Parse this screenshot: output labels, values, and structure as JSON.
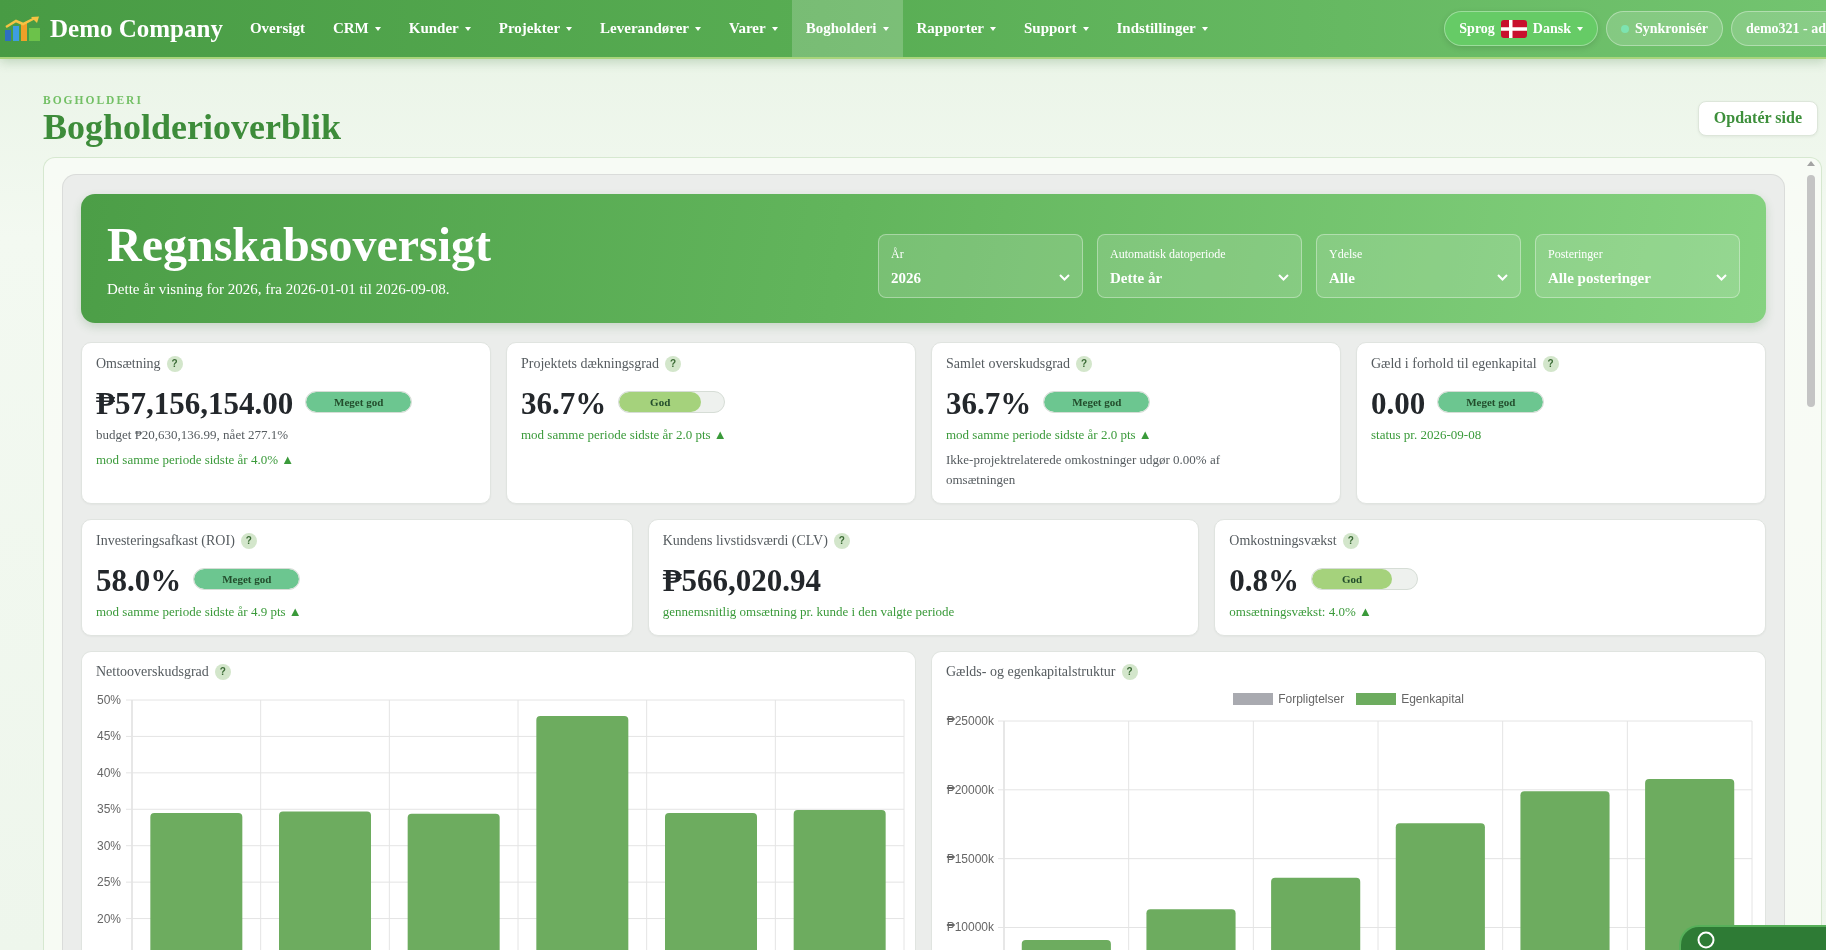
{
  "nav": {
    "brand": "Demo Company",
    "items": [
      {
        "label": "Oversigt",
        "has_menu": false,
        "selected": false
      },
      {
        "label": "CRM",
        "has_menu": true,
        "selected": false
      },
      {
        "label": "Kunder",
        "has_menu": true,
        "selected": false
      },
      {
        "label": "Projekter",
        "has_menu": true,
        "selected": false
      },
      {
        "label": "Leverandører",
        "has_menu": true,
        "selected": false
      },
      {
        "label": "Varer",
        "has_menu": true,
        "selected": false
      },
      {
        "label": "Bogholderi",
        "has_menu": true,
        "selected": true
      },
      {
        "label": "Rapporter",
        "has_menu": true,
        "selected": false
      },
      {
        "label": "Support",
        "has_menu": true,
        "selected": false
      },
      {
        "label": "Indstillinger",
        "has_menu": true,
        "selected": false
      }
    ],
    "language": {
      "label": "Sprog",
      "value": "Dansk"
    },
    "sync": {
      "label": "Synkronisér",
      "online": true
    },
    "user": {
      "label": "demo321 - ad"
    }
  },
  "header": {
    "eyebrow": "BOGHOLDERI",
    "title": "Bogholderioverblik",
    "refresh_button": "Opdatér side"
  },
  "banner": {
    "title": "Regnskabsoversigt",
    "subtitle": "Dette år visning for 2026, fra 2026-01-01 til 2026-09-08.",
    "filters": [
      {
        "label": "År",
        "value": "2026"
      },
      {
        "label": "Automatisk datoperiode",
        "value": "Dette år"
      },
      {
        "label": "Ydelse",
        "value": "Alle"
      },
      {
        "label": "Posteringer",
        "value": "Alle posteringer"
      }
    ]
  },
  "kpi_rows": [
    {
      "cards": [
        {
          "title": "Omsætning",
          "help": "?",
          "value": "₱57,156,154.00",
          "rating": {
            "label": "Meget god",
            "level": 1,
            "color": "#6cc690"
          },
          "notes": [
            {
              "text": "budget ₱20,630,136.99, nået 277.1%",
              "kind": "muted"
            },
            {
              "text": "mod samme periode sidste år 4.0% ▲",
              "kind": "accent"
            }
          ]
        },
        {
          "title": "Projektets dækningsgrad",
          "help": "?",
          "value": "36.7%",
          "rating": {
            "label": "God",
            "level": 0.78,
            "color": "#a5d27c"
          },
          "notes": [
            {
              "text": "mod samme periode sidste år 2.0 pts ▲",
              "kind": "accent"
            }
          ]
        },
        {
          "title": "Samlet overskudsgrad",
          "help": "?",
          "value": "36.7%",
          "rating": {
            "label": "Meget god",
            "level": 1,
            "color": "#6cc690"
          },
          "notes": [
            {
              "text": "mod samme periode sidste år 2.0 pts ▲",
              "kind": "accent"
            },
            {
              "text": "Ikke-projektrelaterede omkostninger udgør 0.00% af omsætningen",
              "kind": "muted"
            }
          ]
        },
        {
          "title": "Gæld i forhold til egenkapital",
          "help": "?",
          "value": "0.00",
          "rating": {
            "label": "Meget god",
            "level": 1,
            "color": "#6cc690"
          },
          "notes": [
            {
              "text": "status pr. 2026-09-08",
              "kind": "accent"
            }
          ]
        }
      ]
    },
    {
      "cards": [
        {
          "title": "Investeringsafkast (ROI)",
          "help": "?",
          "value": "58.0%",
          "rating": {
            "label": "Meget god",
            "level": 1,
            "color": "#6cc690"
          },
          "notes": [
            {
              "text": "mod samme periode sidste år 4.9 pts ▲",
              "kind": "accent"
            }
          ]
        },
        {
          "title": "Kundens livstidsværdi (CLV)",
          "help": "?",
          "value": "₱566,020.94",
          "notes": [
            {
              "text": "gennemsnitlig omsætning pr. kunde i den valgte periode",
              "kind": "accent"
            }
          ]
        },
        {
          "title": "Omkostningsvækst",
          "help": "?",
          "value": "0.8%",
          "rating": {
            "label": "God",
            "level": 0.76,
            "color": "#a5d27c"
          },
          "notes": [
            {
              "text": "omsætningsvækst: 4.0% ▲",
              "kind": "accent"
            }
          ]
        }
      ]
    }
  ],
  "charts": [
    {
      "title": "Nettooverskudsgrad",
      "help": "?",
      "chart_data": {
        "type": "bar",
        "values": [
          34.5,
          34.7,
          34.4,
          47.8,
          34.5,
          34.9
        ],
        "ylim": [
          15,
          50
        ],
        "yticks": [
          {
            "value": 50,
            "label": "50%"
          },
          {
            "value": 45,
            "label": "45%"
          },
          {
            "value": 40,
            "label": "40%"
          },
          {
            "value": 35,
            "label": "35%"
          },
          {
            "value": 30,
            "label": "30%"
          },
          {
            "value": 25,
            "label": "25%"
          },
          {
            "value": 20,
            "label": "20%"
          }
        ],
        "grid": true
      }
    },
    {
      "title": "Gælds- og egenkapitalstruktur",
      "help": "?",
      "chart_data": {
        "type": "bar",
        "series": [
          {
            "name": "Forpligtelser",
            "color": "#a9aab0"
          },
          {
            "name": "Egenkapital",
            "color": "#6dac5f",
            "values": [
              9090,
              11320,
              13620,
              17580,
              19890,
              20790
            ]
          }
        ],
        "ylim": [
          8000,
          25000
        ],
        "yticks": [
          {
            "value": 25000,
            "label": "₱25000k"
          },
          {
            "value": 20000,
            "label": "₱20000k"
          },
          {
            "value": 15000,
            "label": "₱15000k"
          },
          {
            "value": 10000,
            "label": "₱10000k"
          }
        ],
        "grid": true
      }
    }
  ]
}
